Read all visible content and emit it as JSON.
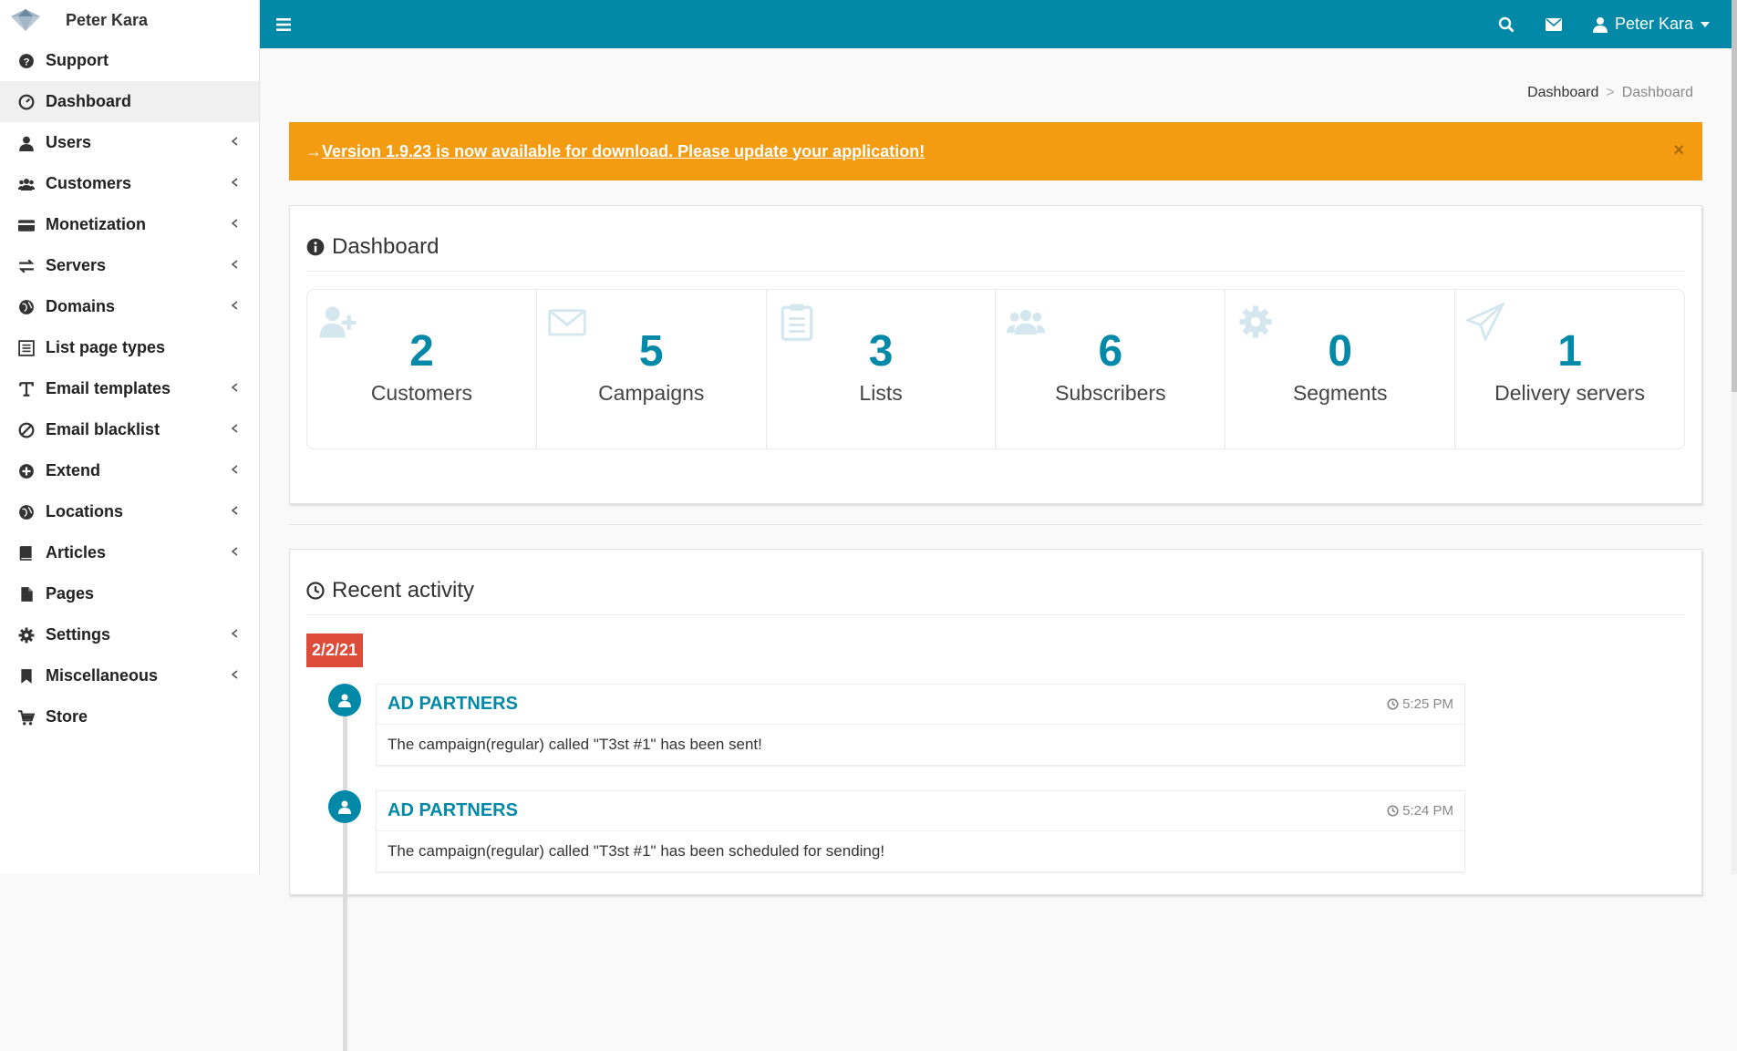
{
  "brand": {
    "name": "Peter Kara"
  },
  "sidebar": {
    "items": [
      {
        "label": "Support",
        "icon": "question-circle-icon",
        "has_submenu": false,
        "active": false
      },
      {
        "label": "Dashboard",
        "icon": "dashboard-icon",
        "has_submenu": false,
        "active": true
      },
      {
        "label": "Users",
        "icon": "user-icon",
        "has_submenu": true,
        "active": false
      },
      {
        "label": "Customers",
        "icon": "users-icon",
        "has_submenu": true,
        "active": false
      },
      {
        "label": "Monetization",
        "icon": "credit-card-icon",
        "has_submenu": true,
        "active": false
      },
      {
        "label": "Servers",
        "icon": "exchange-icon",
        "has_submenu": true,
        "active": false
      },
      {
        "label": "Domains",
        "icon": "globe-icon",
        "has_submenu": true,
        "active": false
      },
      {
        "label": "List page types",
        "icon": "list-alt-icon",
        "has_submenu": false,
        "active": false
      },
      {
        "label": "Email templates",
        "icon": "text-icon",
        "has_submenu": true,
        "active": false
      },
      {
        "label": "Email blacklist",
        "icon": "ban-icon",
        "has_submenu": true,
        "active": false
      },
      {
        "label": "Extend",
        "icon": "plus-circle-icon",
        "has_submenu": true,
        "active": false
      },
      {
        "label": "Locations",
        "icon": "globe-icon",
        "has_submenu": true,
        "active": false
      },
      {
        "label": "Articles",
        "icon": "book-icon",
        "has_submenu": true,
        "active": false
      },
      {
        "label": "Pages",
        "icon": "file-icon",
        "has_submenu": false,
        "active": false
      },
      {
        "label": "Settings",
        "icon": "cog-icon",
        "has_submenu": true,
        "active": false
      },
      {
        "label": "Miscellaneous",
        "icon": "bookmark-icon",
        "has_submenu": true,
        "active": false
      },
      {
        "label": "Store",
        "icon": "shopping-cart-icon",
        "has_submenu": false,
        "active": false
      }
    ]
  },
  "topbar": {
    "user_name": "Peter Kara",
    "icons": [
      "menu-icon",
      "search-icon",
      "envelope-icon",
      "user-icon",
      "caret-down-icon"
    ]
  },
  "breadcrumb": {
    "items": [
      "Dashboard",
      "Dashboard"
    ],
    "separator": ">"
  },
  "alert": {
    "arrow": "→",
    "text": "Version 1.9.23 is now available for download. Please update your application!",
    "close": "×",
    "color": "#f39c12"
  },
  "dashboard": {
    "title": "Dashboard",
    "stats": [
      {
        "value": "2",
        "label": "Customers",
        "icon": "user-plus-icon"
      },
      {
        "value": "5",
        "label": "Campaigns",
        "icon": "envelope-icon"
      },
      {
        "value": "3",
        "label": "Lists",
        "icon": "clipboard-icon"
      },
      {
        "value": "6",
        "label": "Subscribers",
        "icon": "users-icon"
      },
      {
        "value": "0",
        "label": "Segments",
        "icon": "cog-icon"
      },
      {
        "value": "1",
        "label": "Delivery servers",
        "icon": "paper-plane-icon"
      }
    ]
  },
  "activity": {
    "title": "Recent activity",
    "date": "2/2/21",
    "items": [
      {
        "name": "AD PARTNERS",
        "time": "5:25 PM",
        "message": "The campaign(regular) called \"T3st #1\" has been sent!"
      },
      {
        "name": "AD PARTNERS",
        "time": "5:24 PM",
        "message": "The campaign(regular) called \"T3st #1\" has been scheduled for sending!"
      }
    ]
  },
  "colors": {
    "accent": "#0389a8",
    "warning": "#f39c12",
    "danger": "#dd4b39"
  }
}
